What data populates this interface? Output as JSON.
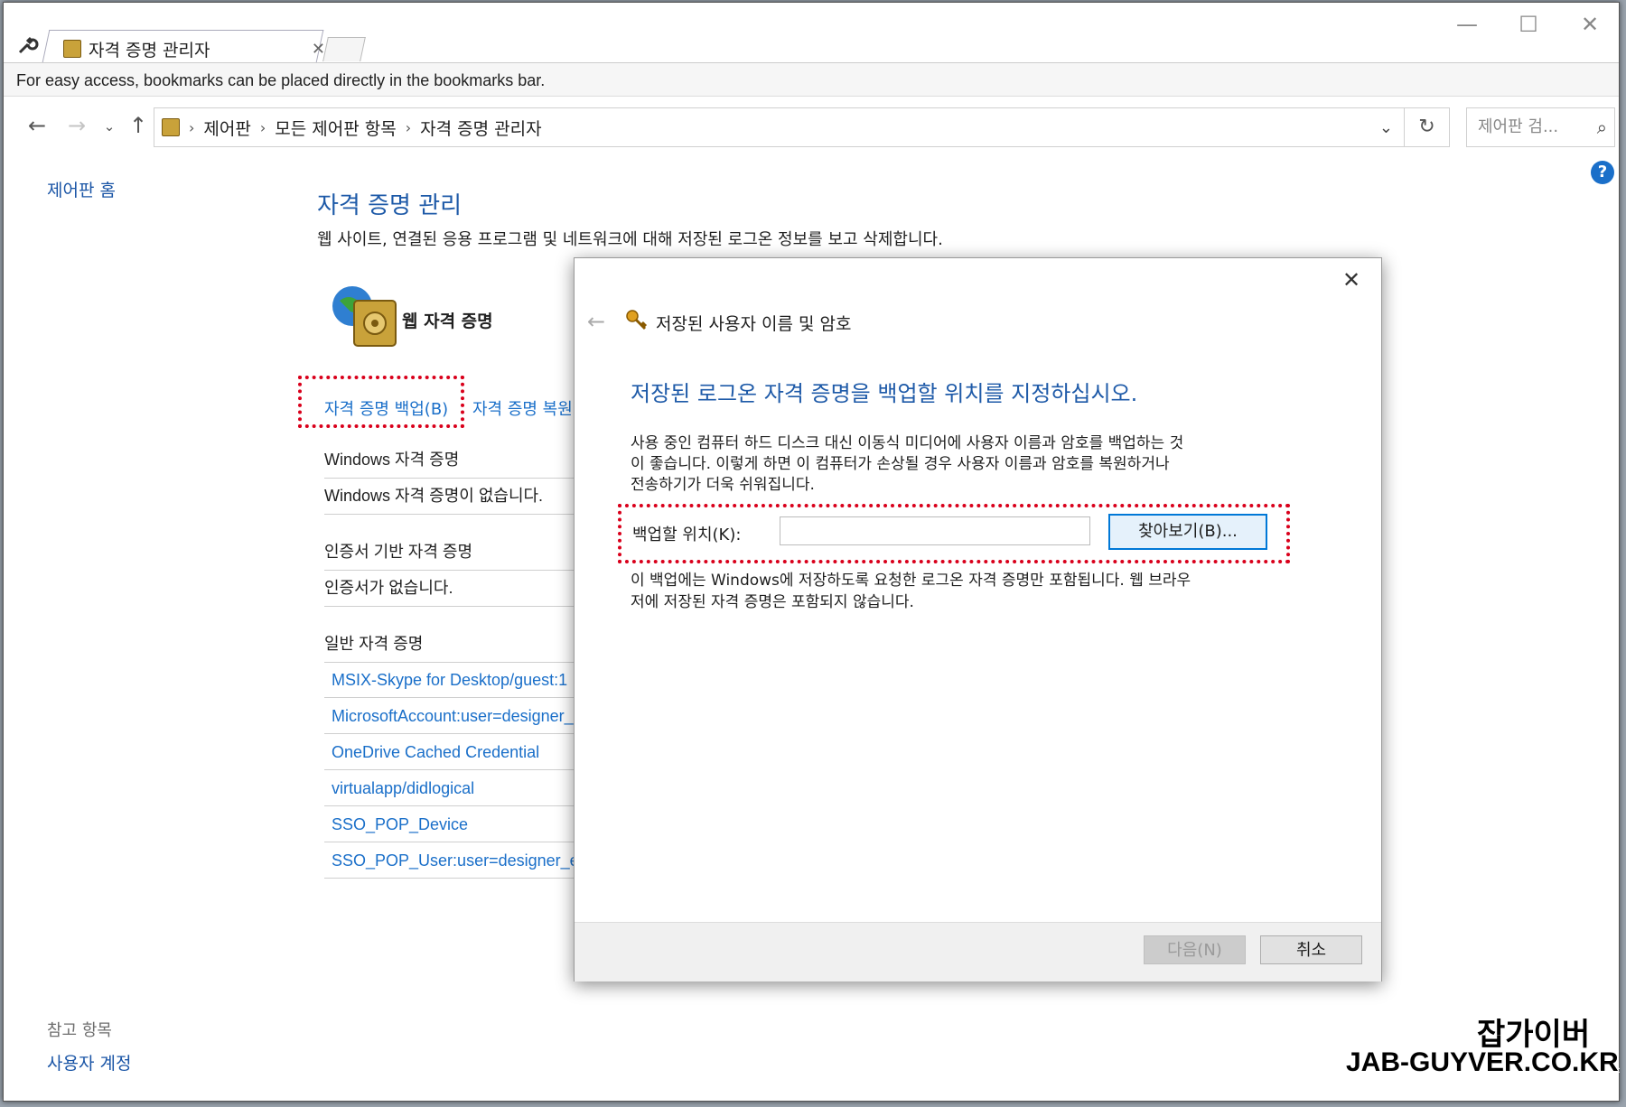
{
  "browser": {
    "tab_title": "자격 증명 관리자",
    "bookmarks_hint": "For easy access, bookmarks can be placed directly in the bookmarks bar."
  },
  "address": {
    "breadcrumb": [
      "제어판",
      "모든 제어판 항목",
      "자격 증명 관리자"
    ],
    "search_placeholder": "제어판 검..."
  },
  "sidebar": {
    "home": "제어판 홈",
    "see_also_label": "참고 항목",
    "user_accounts": "사용자 계정"
  },
  "main": {
    "title": "자격 증명 관리",
    "description": "웹 사이트, 연결된 응용 프로그램 및 네트워크에 대해 저장된 로그온 정보를 보고 삭제합니다.",
    "section_label": "웹 자격 증명",
    "backup_link": "자격 증명 백업(B)",
    "restore_link": "자격 증명 복원",
    "windows_header": "Windows 자격 증명",
    "windows_empty": "Windows 자격 증명이 없습니다.",
    "cert_header": "인증서 기반 자격 증명",
    "cert_empty": "인증서가 없습니다.",
    "generic_header": "일반 자격 증명",
    "generic_items": [
      "MSIX-Skype for Desktop/guest:1",
      "MicrosoftAccount:user=designer_",
      "OneDrive Cached Credential",
      "virtualapp/didlogical",
      "SSO_POP_Device",
      "SSO_POP_User:user=designer_ew"
    ]
  },
  "dialog": {
    "title": "저장된 사용자 이름 및 암호",
    "heading": "저장된 로그온 자격 증명을 백업할 위치를 지정하십시오.",
    "body_lines": [
      "사용 중인 컴퓨터 하드 디스크 대신 이동식 미디어에 사용자 이름과 암호를 백업하는 것",
      "이 좋습니다. 이렇게 하면 이 컴퓨터가 손상될 경우 사용자 이름과 암호를 복원하거나",
      "전송하기가 더욱 쉬워집니다."
    ],
    "location_label": "백업할 위치(K):",
    "location_value": "",
    "browse_button": "찾아보기(B)...",
    "note_lines": [
      "이 백업에는 Windows에 저장하도록 요청한 로그온 자격 증명만 포함됩니다. 웹 브라우",
      "저에 저장된 자격 증명은 포함되지 않습니다."
    ],
    "next_button": "다음(N)",
    "cancel_button": "취소"
  },
  "watermark": {
    "line1": "잡가이버",
    "line2": "JAB-GUYVER.CO.KR"
  }
}
